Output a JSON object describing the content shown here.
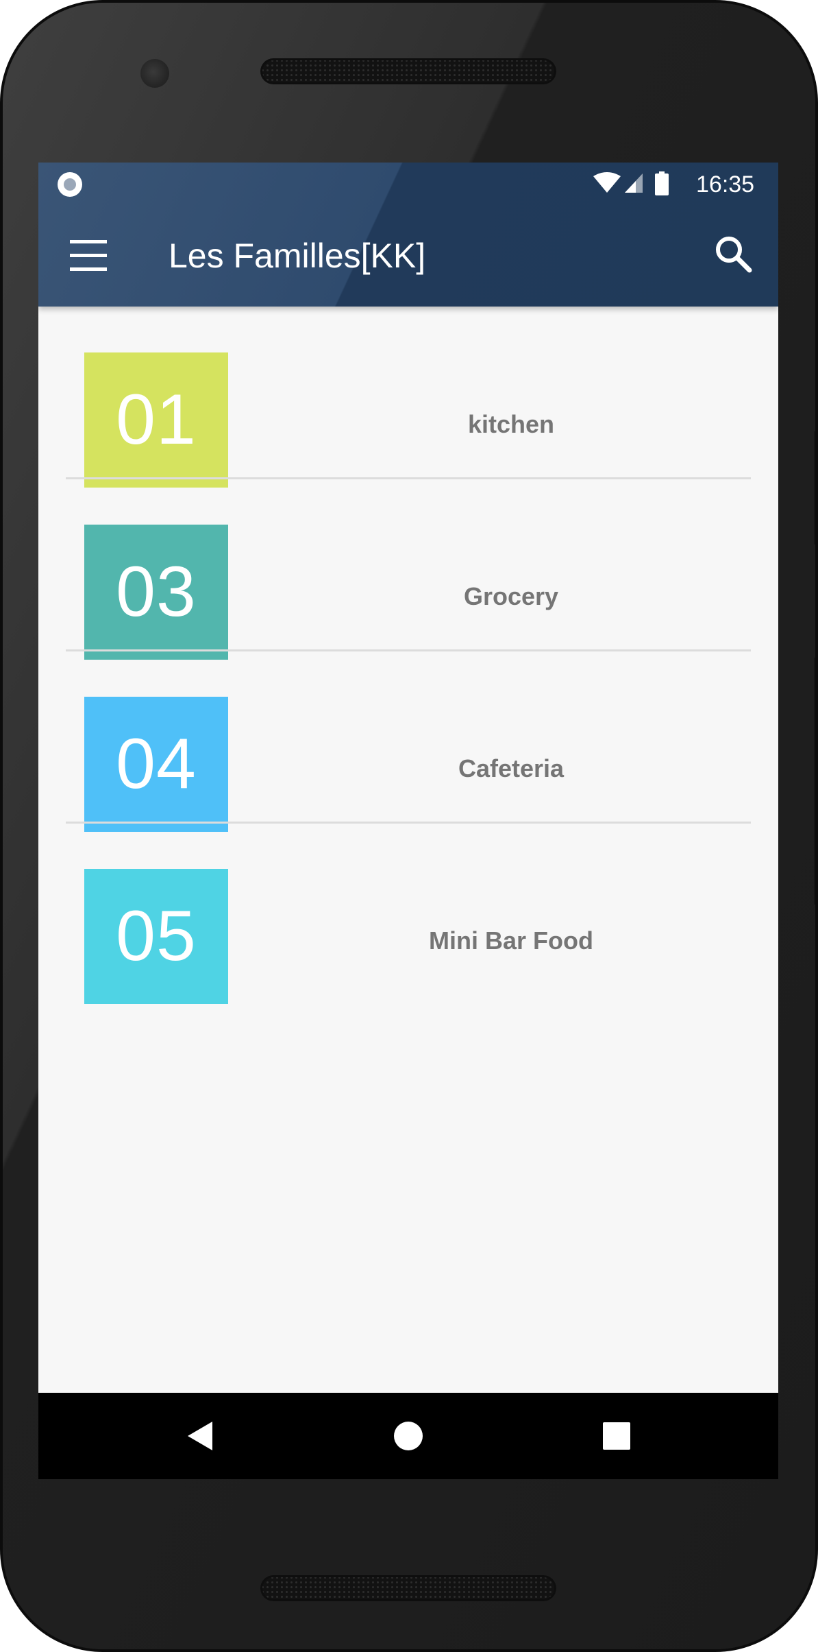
{
  "status_bar": {
    "time": "16:35",
    "icons": [
      "notification-dot-icon",
      "wifi-icon",
      "cell-signal-icon",
      "battery-icon"
    ]
  },
  "app_bar": {
    "title": "Les Familles[KK]",
    "menu_icon": "hamburger-menu-icon",
    "search_icon": "search-icon",
    "color": "#2a4464"
  },
  "families": [
    {
      "code": "01",
      "name": "kitchen",
      "color": "#d5e35f"
    },
    {
      "code": "03",
      "name": "Grocery",
      "color": "#52b6ad"
    },
    {
      "code": "04",
      "name": "Cafeteria",
      "color": "#4fc0f8"
    },
    {
      "code": "05",
      "name": "Mini Bar Food",
      "color": "#4fd3e4"
    }
  ],
  "nav_bar": {
    "buttons": [
      "back-icon",
      "home-icon",
      "recents-icon"
    ]
  }
}
